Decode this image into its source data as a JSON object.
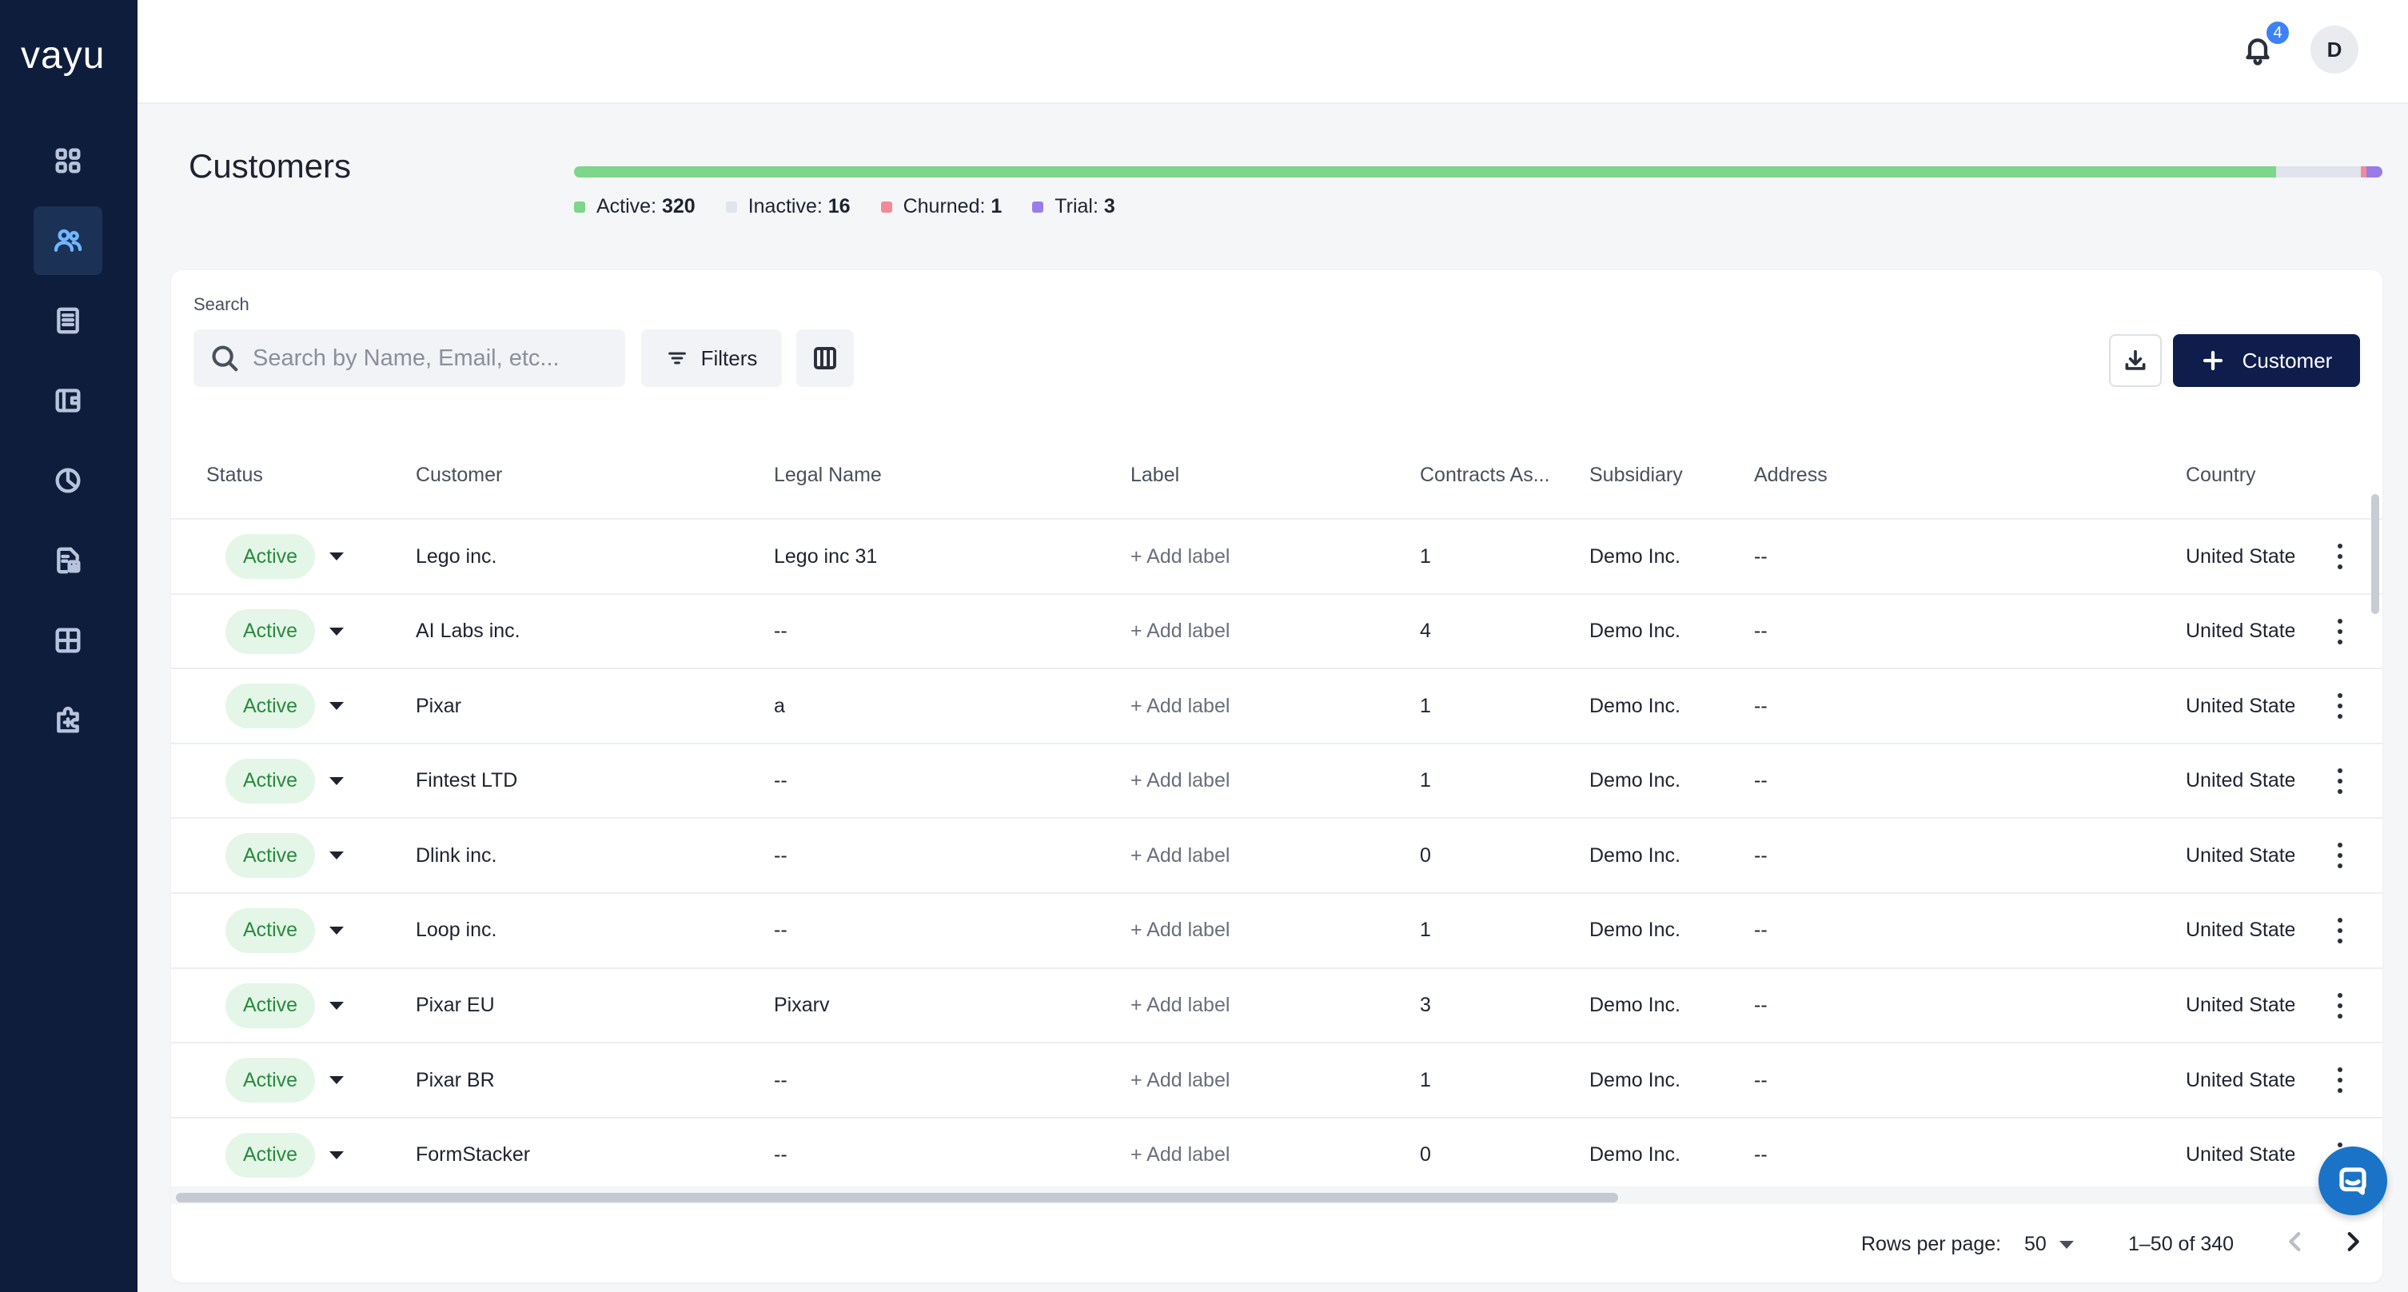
{
  "app": {
    "logo": "vayu"
  },
  "nav": [
    {
      "name": "dashboard",
      "icon": "grid-icon",
      "active": false
    },
    {
      "name": "customers",
      "icon": "users-icon",
      "active": true
    },
    {
      "name": "invoices",
      "icon": "receipt-icon",
      "active": false
    },
    {
      "name": "wallet",
      "icon": "wallet-icon",
      "active": false
    },
    {
      "name": "reports",
      "icon": "pie-chart-icon",
      "active": false
    },
    {
      "name": "billing",
      "icon": "document-chart-icon",
      "active": false
    },
    {
      "name": "products",
      "icon": "layout-icon",
      "active": false
    },
    {
      "name": "integrations",
      "icon": "plugin-icon",
      "active": false
    }
  ],
  "topbar": {
    "notifications_count": "4",
    "avatar_initial": "D"
  },
  "header": {
    "title": "Customers",
    "status_summary": [
      {
        "label": "Active:",
        "value": "320",
        "count": 320,
        "color": "#7dd68a"
      },
      {
        "label": "Inactive:",
        "value": "16",
        "count": 16,
        "color": "#e1e3ee"
      },
      {
        "label": "Churned:",
        "value": "1",
        "count": 1,
        "color": "#f28b99"
      },
      {
        "label": "Trial:",
        "value": "3",
        "count": 3,
        "color": "#9b7bea"
      }
    ]
  },
  "search": {
    "label": "Search",
    "placeholder": "Search by Name, Email, etc...",
    "value": ""
  },
  "toolbar": {
    "filters_label": "Filters",
    "add_customer_label": "Customer"
  },
  "table": {
    "columns": [
      "Status",
      "Customer",
      "Legal Name",
      "Label",
      "Contracts As...",
      "Subsidiary",
      "Address",
      "Country"
    ],
    "rows": [
      {
        "status": "Active",
        "customer": "Lego inc.",
        "legal_name": "Lego inc 31",
        "label": "+ Add label",
        "contracts": "1",
        "subsidiary": "Demo Inc.",
        "address": "--",
        "country": "United States"
      },
      {
        "status": "Active",
        "customer": "AI Labs inc.",
        "legal_name": "--",
        "label": "+ Add label",
        "contracts": "4",
        "subsidiary": "Demo Inc.",
        "address": "--",
        "country": "United States"
      },
      {
        "status": "Active",
        "customer": "Pixar",
        "legal_name": "a",
        "label": "+ Add label",
        "contracts": "1",
        "subsidiary": "Demo Inc.",
        "address": "--",
        "country": "United States"
      },
      {
        "status": "Active",
        "customer": "Fintest LTD",
        "legal_name": "--",
        "label": "+ Add label",
        "contracts": "1",
        "subsidiary": "Demo Inc.",
        "address": "--",
        "country": "United States"
      },
      {
        "status": "Active",
        "customer": "Dlink inc.",
        "legal_name": "--",
        "label": "+ Add label",
        "contracts": "0",
        "subsidiary": "Demo Inc.",
        "address": "--",
        "country": "United States"
      },
      {
        "status": "Active",
        "customer": "Loop inc.",
        "legal_name": "--",
        "label": "+ Add label",
        "contracts": "1",
        "subsidiary": "Demo Inc.",
        "address": "--",
        "country": "United States"
      },
      {
        "status": "Active",
        "customer": "Pixar EU",
        "legal_name": "Pixarv",
        "label": "+ Add label",
        "contracts": "3",
        "subsidiary": "Demo Inc.",
        "address": "--",
        "country": "United States"
      },
      {
        "status": "Active",
        "customer": "Pixar BR",
        "legal_name": "--",
        "label": "+ Add label",
        "contracts": "1",
        "subsidiary": "Demo Inc.",
        "address": "--",
        "country": "United States"
      },
      {
        "status": "Active",
        "customer": "FormStacker",
        "legal_name": "--",
        "label": "+ Add label",
        "contracts": "0",
        "subsidiary": "Demo Inc.",
        "address": "--",
        "country": "United States"
      }
    ]
  },
  "pagination": {
    "rows_per_page_label": "Rows per page:",
    "rows_per_page": "50",
    "range": "1–50 of 340"
  }
}
